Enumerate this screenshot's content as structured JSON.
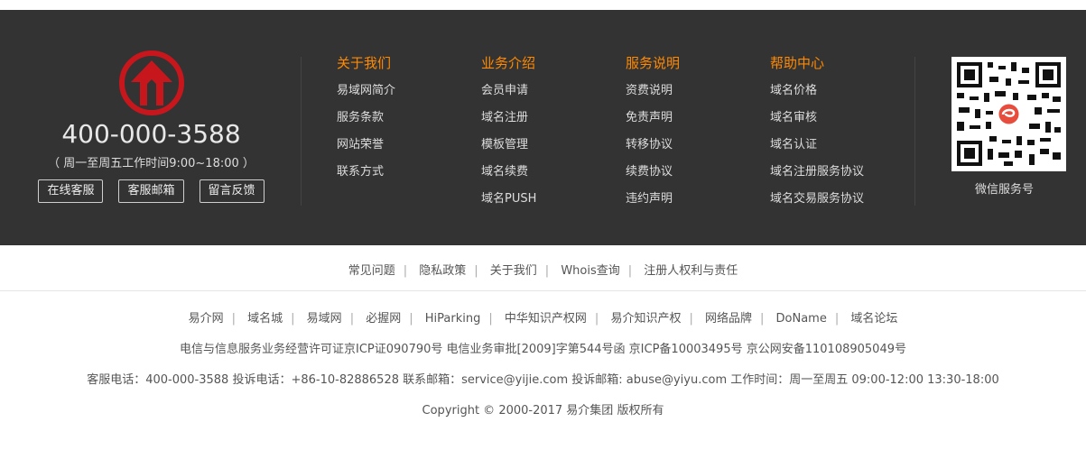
{
  "contact": {
    "phone": "400-000-3588",
    "hours": "（ 周一至周五工作时间9:00~18:00 ）",
    "buttons": [
      "在线客服",
      "客服邮箱",
      "留言反馈"
    ]
  },
  "columns": [
    {
      "title": "关于我们",
      "items": [
        "易域网简介",
        "服务条款",
        "网站荣誉",
        "联系方式"
      ]
    },
    {
      "title": "业务介绍",
      "items": [
        "会员申请",
        "域名注册",
        "模板管理",
        "域名续费",
        "域名PUSH"
      ]
    },
    {
      "title": "服务说明",
      "items": [
        "资费说明",
        "免责声明",
        "转移协议",
        "续费协议",
        "违约声明"
      ]
    },
    {
      "title": "帮助中心",
      "items": [
        "域名价格",
        "域名审核",
        "域名认证",
        "域名注册服务协议",
        "域名交易服务协议"
      ]
    }
  ],
  "qr": {
    "label": "微信服务号",
    "icon": "wechat-qr-code"
  },
  "links_primary": [
    "常见问题",
    "隐私政策",
    "关于我们",
    "Whois查询",
    "注册人权利与责任"
  ],
  "links_partner": [
    "易介网",
    "域名城",
    "易域网",
    "必握网",
    "HiParking",
    "中华知识产权网",
    "易介知识产权",
    "网络品牌",
    "DoName",
    "域名论坛"
  ],
  "footer": {
    "license": "电信与信息服务业务经营许可证京ICP证090790号 电信业务审批[2009]字第544号函 京ICP备10003495号 京公网安备110108905049号",
    "contact_line": "客服电话：400-000-3588 投诉电话：+86-10-82886528 联系邮箱：service@yijie.com 投诉邮箱: abuse@yiyu.com 工作时间：周一至周五 09:00-12:00 13:30-18:00",
    "copyright": "Copyright © 2000-2017 易介集团 版权所有"
  },
  "colors": {
    "dark_bg": "#333333",
    "accent": "#ff8a00",
    "logo_red": "#c8161d"
  }
}
